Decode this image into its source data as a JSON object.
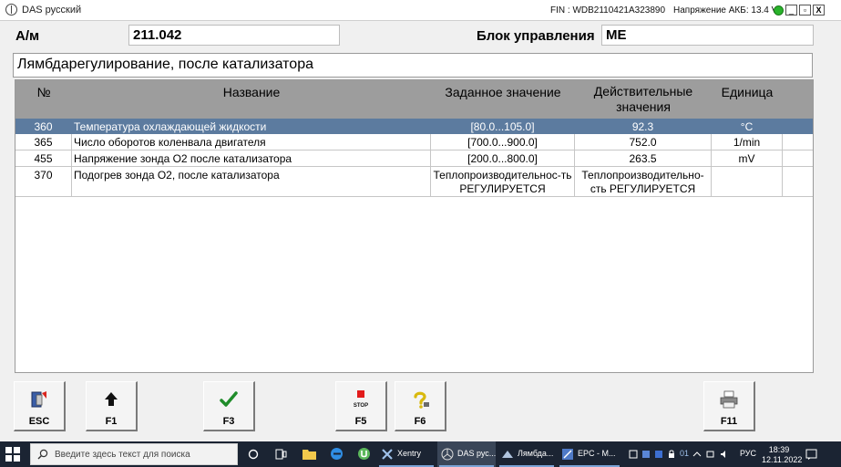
{
  "titlebar": {
    "title": "DAS русский",
    "fin": "FIN : WDB2110421A323890",
    "battery": "Напряжение АКБ: 13.4 V",
    "min": "_",
    "max": "▫",
    "close": "X"
  },
  "header": {
    "am_label": "А/м",
    "am_value": "211.042",
    "ecu_label": "Блок управления",
    "ecu_value": "ME",
    "section_title": "Лямбдарегулирование, после катализатора"
  },
  "table": {
    "columns": {
      "num": "№",
      "name": "Название",
      "set": "Заданное значение",
      "actual": "Действительные значения",
      "unit": "Единица"
    },
    "rows": [
      {
        "num": "360",
        "name": "Температура охлаждающей жидкости",
        "set": "[80.0...105.0]",
        "actual": "92.3",
        "unit": "°C",
        "selected": true
      },
      {
        "num": "365",
        "name": "Число оборотов коленвала двигателя",
        "set": "[700.0...900.0]",
        "actual": "752.0",
        "unit": "1/min"
      },
      {
        "num": "455",
        "name": "Напряжение зонда O2 после катализатора",
        "set": "[200.0...800.0]",
        "actual": "263.5",
        "unit": "mV"
      },
      {
        "num": "370",
        "name": "Подогрев зонда O2, после катализатора",
        "set": "Теплопроизводительнос-ть РЕГУЛИРУЕТСЯ",
        "actual": "Теплопроизводительно-сть РЕГУЛИРУЕТСЯ",
        "unit": ""
      }
    ]
  },
  "buttons": {
    "esc": "ESC",
    "f1": "F1",
    "f3": "F3",
    "f5": "F5",
    "f5_stop": "STOP",
    "f6": "F6",
    "f11": "F11"
  },
  "taskbar": {
    "search_placeholder": "Введите здесь текст для поиска",
    "apps": {
      "xentry": "Xentry",
      "das": "DAS рус...",
      "lambda": "Лямбда...",
      "epc": "EPC - M..."
    },
    "tray_lang": "РУС",
    "tray_num": "01",
    "time": "18:39",
    "date": "12.11.2022"
  },
  "colors": {
    "selected_row": "#5c7b9f",
    "header_bg": "#9d9d9d",
    "status_led": "#29b32b"
  }
}
